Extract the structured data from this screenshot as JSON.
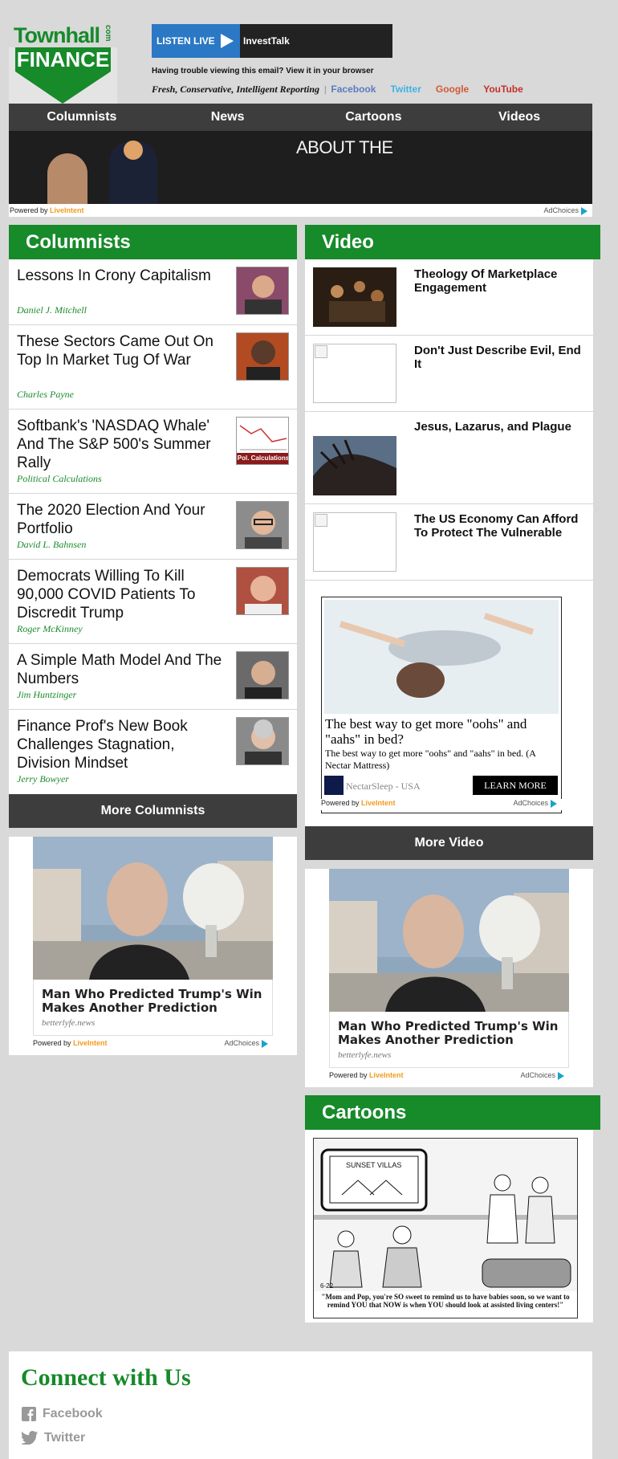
{
  "header": {
    "logo_top": "Townhall",
    "logo_com": "com",
    "logo_bottom": "FINANCE",
    "listen_label": "LISTEN LIVE",
    "listen_station": "InvestTalk",
    "trouble_text": "Having trouble viewing this email? View it in your browser",
    "tagline": "Fresh, Conservative, Intelligent Reporting",
    "separator": "|",
    "social": [
      {
        "label": "Facebook",
        "color": "#5b7bc0"
      },
      {
        "label": "Twitter",
        "color": "#3fb2e6"
      },
      {
        "label": "Google",
        "color": "#d2583a"
      },
      {
        "label": "YouTube",
        "color": "#c4302b"
      }
    ]
  },
  "nav": [
    "Columnists",
    "News",
    "Cartoons",
    "Videos"
  ],
  "banner": {
    "text": "ABOUT THE",
    "powered_prefix": "Powered by",
    "powered_brand": "LiveIntent",
    "adchoices": "AdChoices"
  },
  "columnists": {
    "title": "Columnists",
    "items": [
      {
        "title": "Lessons In Crony Capitalism",
        "author": "Daniel J. Mitchell",
        "thumb_icon": "author-photo-icon",
        "thumb_color": "#8a4a6a"
      },
      {
        "title": "These Sectors Came Out On Top In Market Tug Of War",
        "author": "Charles Payne",
        "thumb_icon": "author-photo-icon",
        "thumb_color": "#b24a22"
      },
      {
        "title": "Softbank's 'NASDAQ Whale' And The S&P 500's Summer Rally",
        "author": "Political Calculations",
        "thumb_icon": "chart-logo-icon",
        "thumb_label": "Pol. Calculations",
        "thumb_color": "#8b1a1a"
      },
      {
        "title": "The 2020 Election And Your Portfolio",
        "author": "David L. Bahnsen",
        "thumb_icon": "author-photo-icon",
        "thumb_color": "#777777"
      },
      {
        "title": "Democrats Willing To Kill 90,000 COVID Patients To Discredit Trump",
        "author": "Roger McKinney",
        "thumb_icon": "author-photo-icon",
        "thumb_color": "#b05040"
      },
      {
        "title": "A Simple Math Model And The Numbers",
        "author": "Jim Huntzinger",
        "thumb_icon": "author-photo-icon",
        "thumb_color": "#6a6a6a"
      },
      {
        "title": "Finance Prof's New Book Challenges Stagnation, Division Mindset",
        "author": "Jerry Bowyer",
        "thumb_icon": "author-photo-icon",
        "thumb_color": "#8a8a8a"
      }
    ],
    "more_label": "More Columnists"
  },
  "video": {
    "title": "Video",
    "items": [
      {
        "title": "Theology Of Marketplace Engagement",
        "thumb": "painting"
      },
      {
        "title": "Don't Just Describe Evil, End It",
        "thumb": "broken"
      },
      {
        "title": "Jesus, Lazarus, and Plague",
        "thumb": "crown"
      },
      {
        "title": "The US Economy Can Afford To Protect The Vulnerable",
        "thumb": "broken"
      }
    ],
    "more_label": "More Video"
  },
  "nectar_ad": {
    "headline": "The best way to get more \"oohs\" and \"aahs\" in bed?",
    "body": "The best way to get more \"oohs\" and \"aahs\" in bed. (A Nectar Mattress)",
    "brand": "NectarSleep - USA",
    "cta": "LEARN MORE"
  },
  "betterlyfe_ad": {
    "headline": "Man Who Predicted Trump's Win Makes Another Prediction",
    "domain": "betterlyfe.news"
  },
  "cartoons": {
    "title": "Cartoons",
    "sign": "SUNSET VILLAS",
    "date": "6-22",
    "caption": "\"Mom and Pop, you're SO sweet to remind us to have babies soon, so we want to remind YOU that NOW is when YOU should look at assisted living centers!\""
  },
  "connect": {
    "title": "Connect with Us",
    "links": [
      {
        "label": "Facebook",
        "icon": "facebook-icon"
      },
      {
        "label": "Twitter",
        "icon": "twitter-icon"
      }
    ]
  }
}
